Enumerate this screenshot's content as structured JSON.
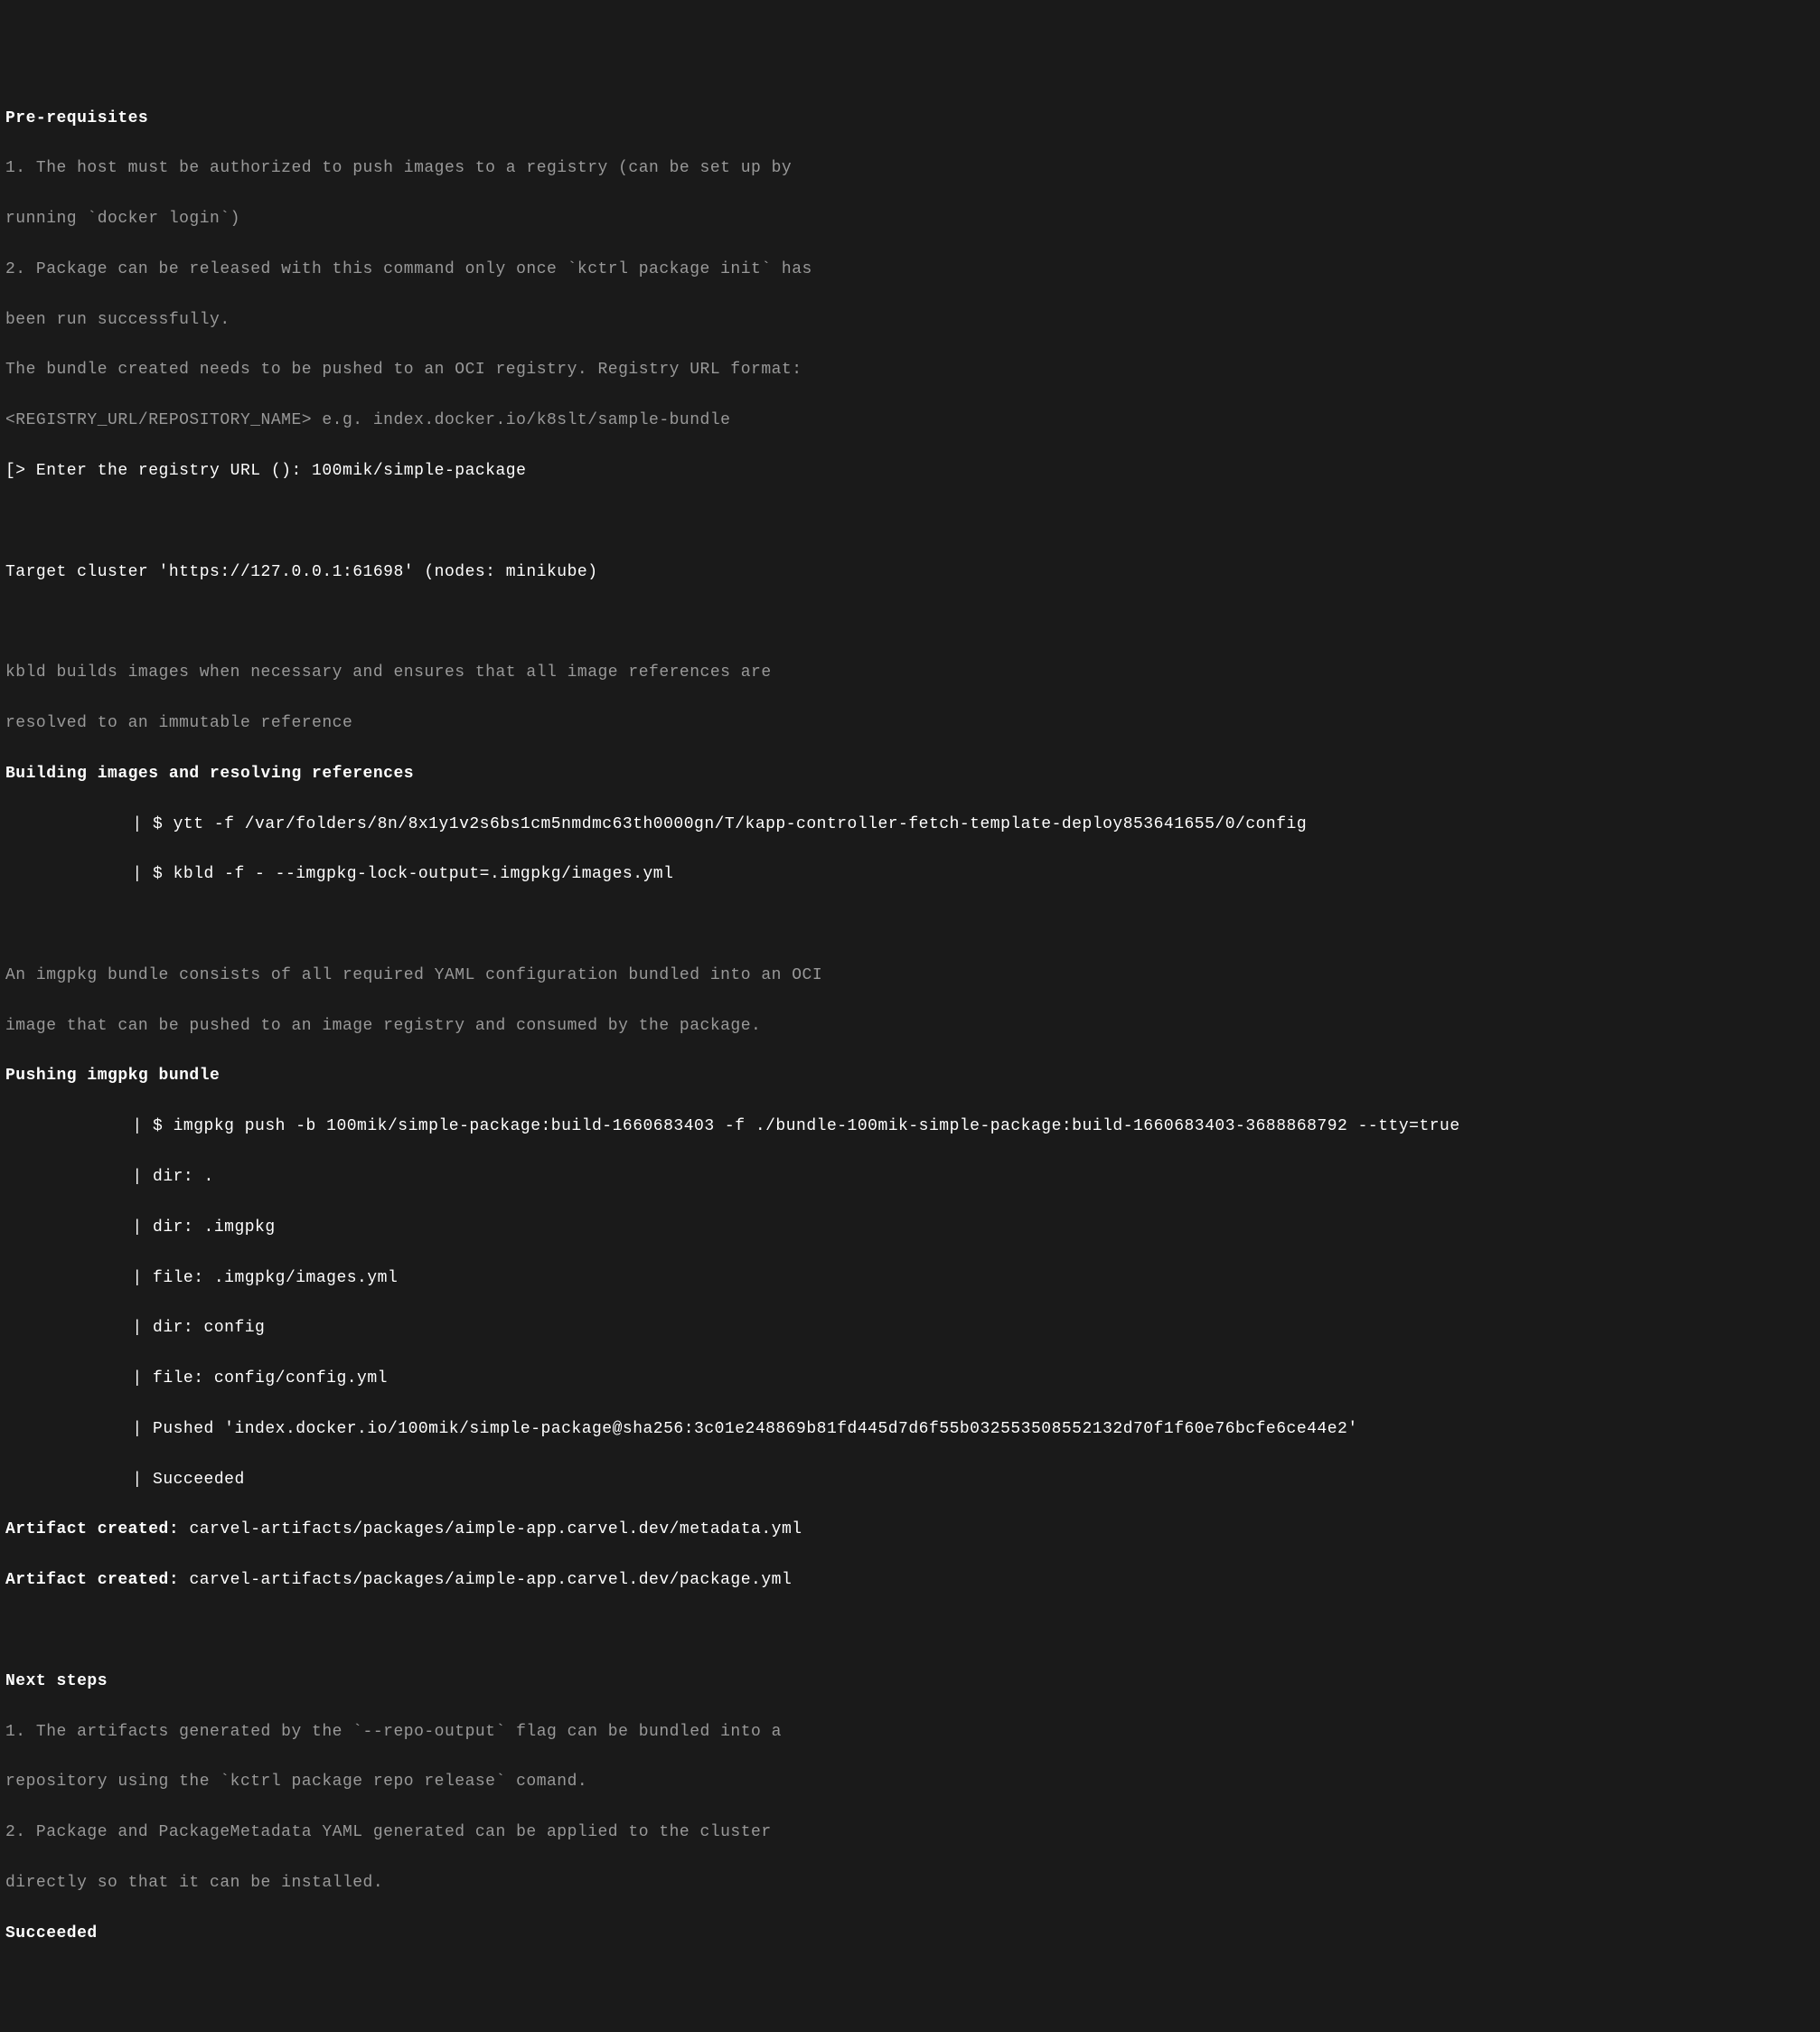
{
  "prereq": {
    "heading": "Pre-requisites",
    "item1_line1": "1. The host must be authorized to push images to a registry (can be set up by",
    "item1_line2": "running `docker login`)",
    "item2_line1": "2. Package can be released with this command only once `kctrl package init` has",
    "item2_line2": "been run successfully.",
    "bundle_line1": "The bundle created needs to be pushed to an OCI registry. Registry URL format:",
    "bundle_line2": "<REGISTRY_URL/REPOSITORY_NAME> e.g. index.docker.io/k8slt/sample-bundle",
    "prompt": "[> Enter the registry URL (): 100mik/simple-package"
  },
  "target": "Target cluster 'https://127.0.0.1:61698' (nodes: minikube)",
  "kbld": {
    "desc_line1": "kbld builds images when necessary and ensures that all image references are",
    "desc_line2": "resolved to an immutable reference",
    "heading": "Building images and resolving references",
    "cmd1": "| $ ytt -f /var/folders/8n/8x1y1v2s6bs1cm5nmdmc63th0000gn/T/kapp-controller-fetch-template-deploy853641655/0/config",
    "cmd2": "| $ kbld -f - --imgpkg-lock-output=.imgpkg/images.yml"
  },
  "imgpkg": {
    "desc_line1": "An imgpkg bundle consists of all required YAML configuration bundled into an OCI",
    "desc_line2": "image that can be pushed to an image registry and consumed by the package.",
    "heading": "Pushing imgpkg bundle",
    "cmd1": "| $ imgpkg push -b 100mik/simple-package:build-1660683403 -f ./bundle-100mik-simple-package:build-1660683403-3688868792 --tty=true",
    "out1": "| dir: .",
    "out2": "| dir: .imgpkg",
    "out3": "| file: .imgpkg/images.yml",
    "out4": "| dir: config",
    "out5": "| file: config/config.yml",
    "out6": "| Pushed 'index.docker.io/100mik/simple-package@sha256:3c01e248869b81fd445d7d6f55b032553508552132d70f1f60e76bcfe6ce44e2'",
    "out7": "| Succeeded"
  },
  "artifacts": {
    "label1": "Artifact created:",
    "path1": " carvel-artifacts/packages/aimple-app.carvel.dev/metadata.yml",
    "label2": "Artifact created:",
    "path2": " carvel-artifacts/packages/aimple-app.carvel.dev/package.yml"
  },
  "next": {
    "heading": "Next steps",
    "item1_line1": "1. The artifacts generated by the `--repo-output` flag can be bundled into a",
    "item1_line2": "repository using the `kctrl package repo release` comand.",
    "item2_line1": "2. Package and PackageMetadata YAML generated can be applied to the cluster",
    "item2_line2": "directly so that it can be installed."
  },
  "success": "Succeeded"
}
